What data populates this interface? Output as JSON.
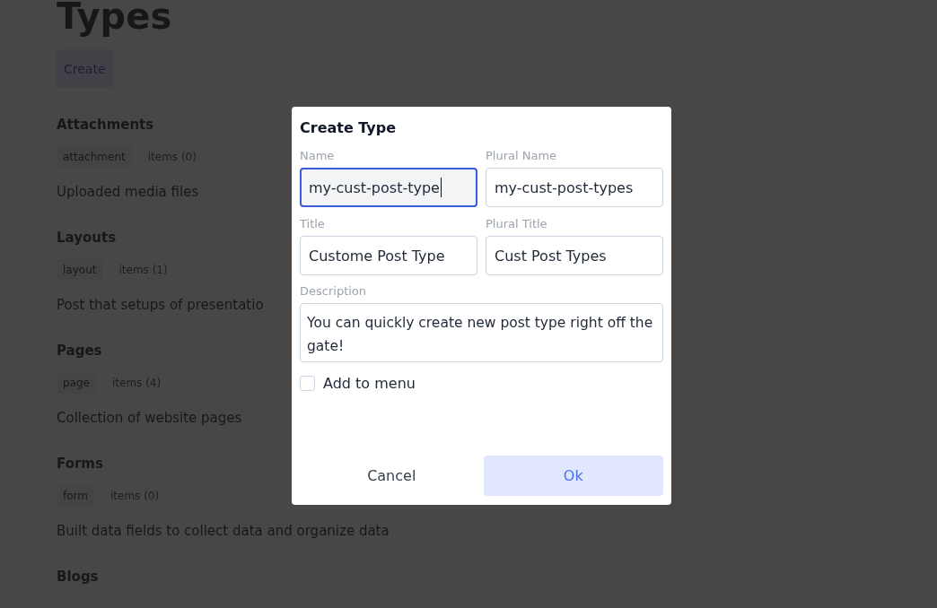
{
  "page": {
    "title": "Types",
    "create_button": "Create",
    "sections": [
      {
        "heading": "Attachments",
        "tag": "attachment",
        "count": "items (0)",
        "description": "Uploaded media files"
      },
      {
        "heading": "Layouts",
        "tag": "layout",
        "count": "items (1)",
        "description": "Post that setups of presentatio"
      },
      {
        "heading": "Pages",
        "tag": "page",
        "count": "items (4)",
        "description": "Collection of website pages"
      },
      {
        "heading": "Forms",
        "tag": "form",
        "count": "items (0)",
        "description": "Built data fields to collect data and organize data"
      },
      {
        "heading": "Blogs"
      }
    ]
  },
  "dialog": {
    "title": "Create Type",
    "fields": [
      {
        "label": "Name",
        "value": "my-cust-post-type",
        "focused": true
      },
      {
        "label": "Plural Name",
        "value": "my-cust-post-types",
        "focused": false
      },
      {
        "label": "Title",
        "value": "Custome Post Type",
        "focused": false
      },
      {
        "label": "Plural Title",
        "value": "Cust Post Types",
        "focused": false
      }
    ],
    "description": {
      "label": "Description",
      "value": "You can quickly create new post type right off the gate!"
    },
    "checkbox": {
      "label": "Add to menu",
      "checked": false
    },
    "buttons": [
      {
        "label": "Cancel",
        "kind": "secondary"
      },
      {
        "label": "Ok",
        "kind": "primary"
      }
    ]
  }
}
